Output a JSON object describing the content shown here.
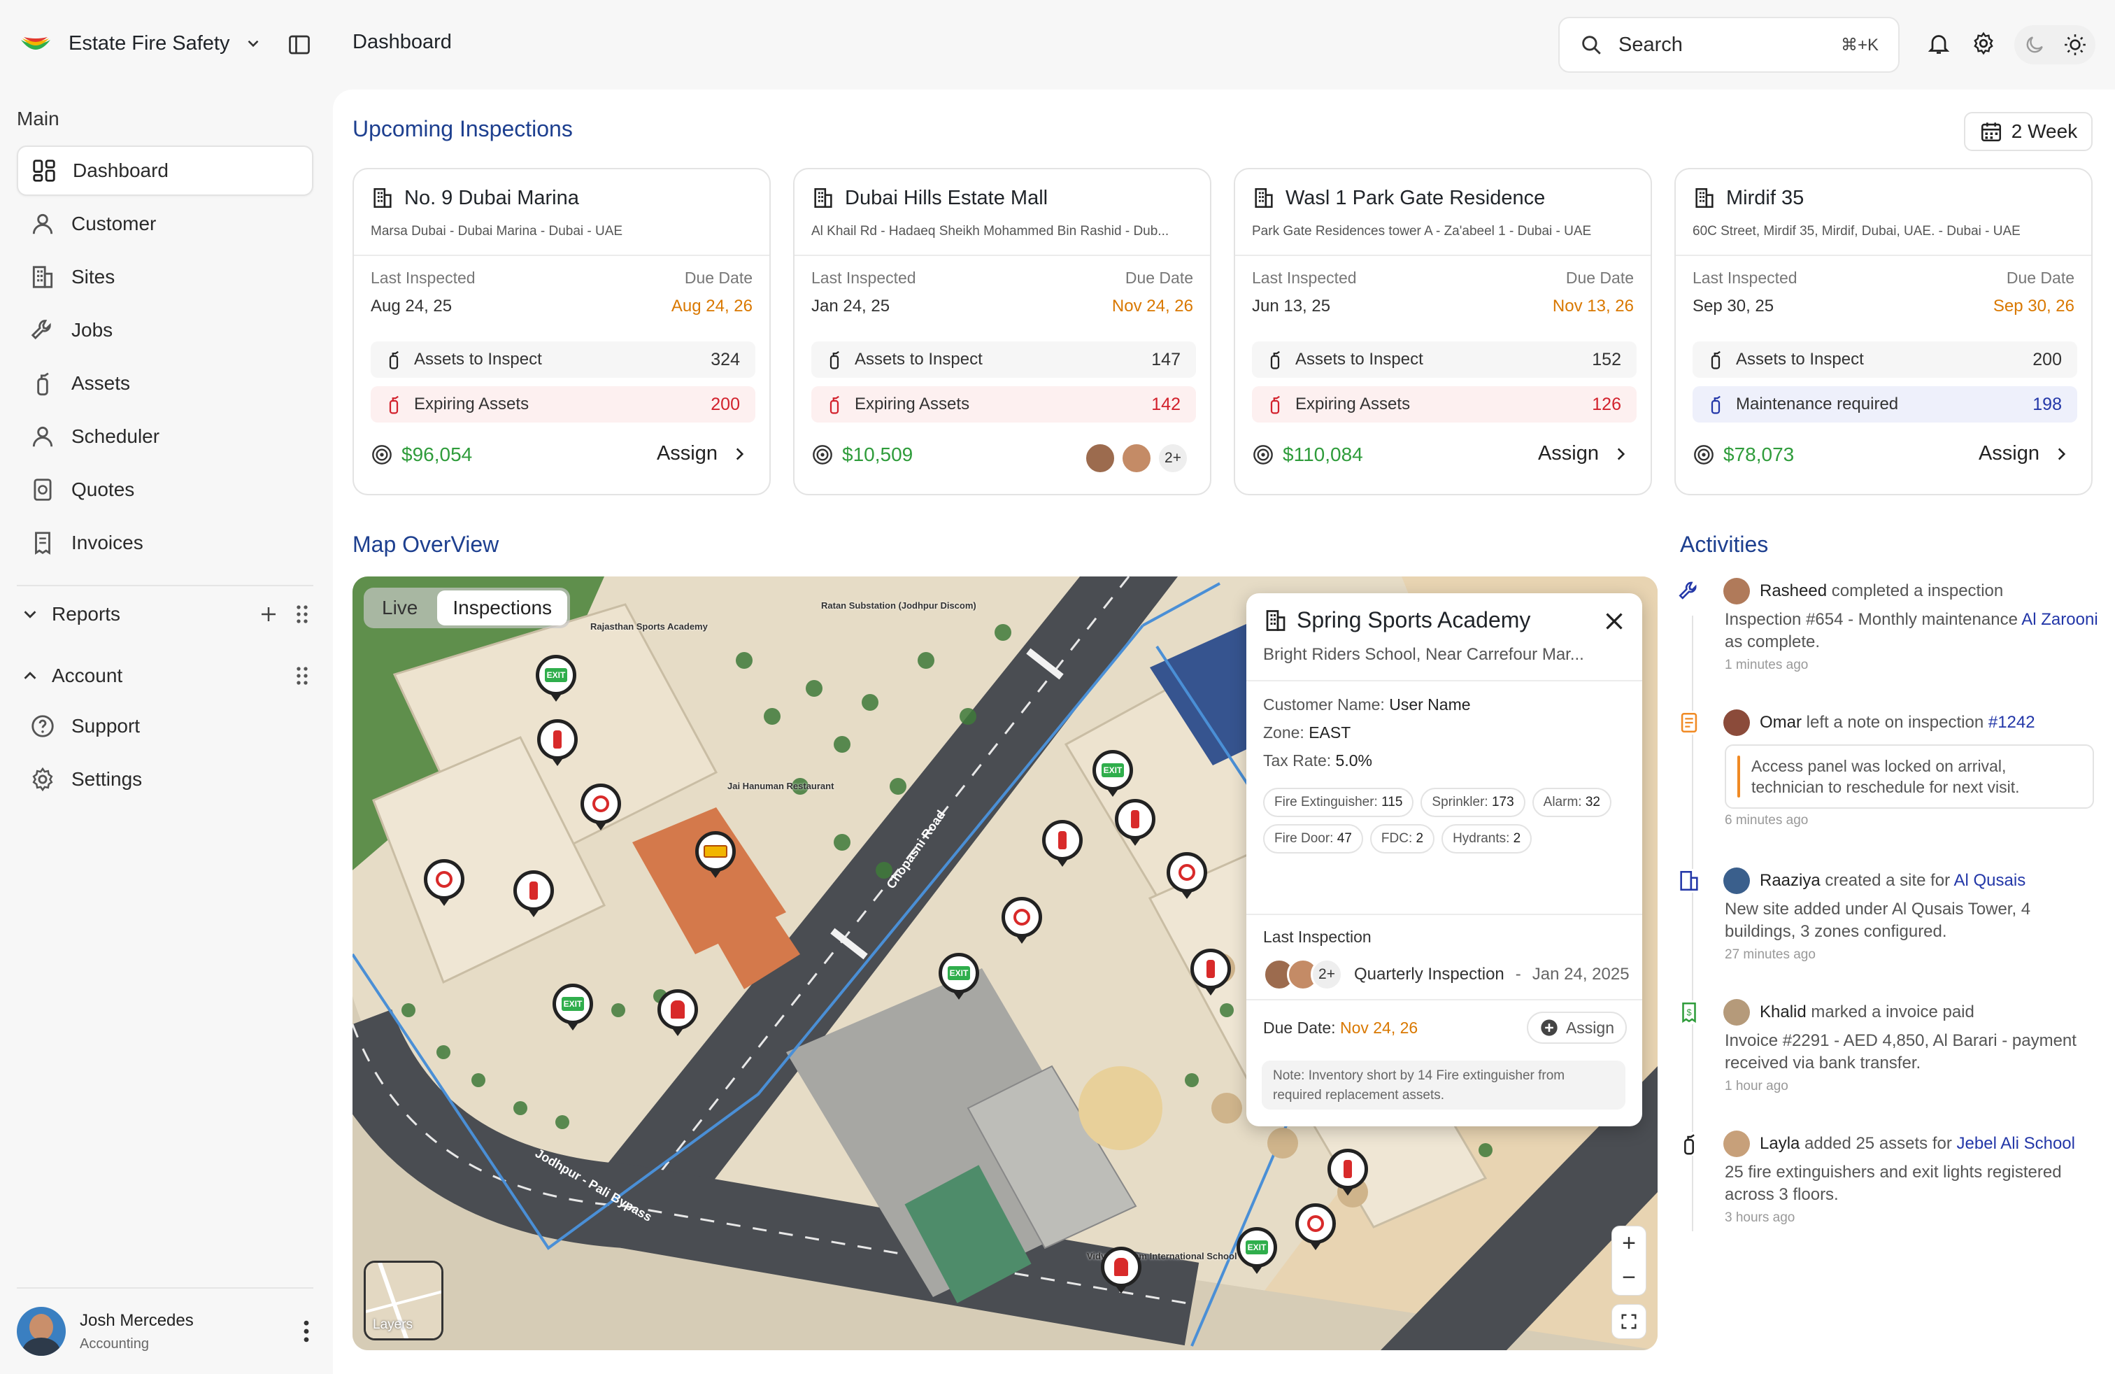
{
  "app": {
    "name": "Estate Fire Safety",
    "page_title": "Dashboard"
  },
  "search": {
    "placeholder": "Search",
    "shortcut": "⌘+K"
  },
  "sidebar": {
    "section_main": "Main",
    "items": [
      {
        "label": "Dashboard",
        "icon": "dashboard-icon",
        "active": true
      },
      {
        "label": "Customer",
        "icon": "user-icon"
      },
      {
        "label": "Sites",
        "icon": "building-icon"
      },
      {
        "label": "Jobs",
        "icon": "wrench-icon"
      },
      {
        "label": "Assets",
        "icon": "extinguisher-icon"
      },
      {
        "label": "Scheduler",
        "icon": "user-icon"
      },
      {
        "label": "Quotes",
        "icon": "quote-icon"
      },
      {
        "label": "Invoices",
        "icon": "invoice-icon"
      }
    ],
    "reports": "Reports",
    "account": "Account",
    "account_items": [
      {
        "label": "Support",
        "icon": "help-icon"
      },
      {
        "label": "Settings",
        "icon": "gear-icon"
      }
    ],
    "user": {
      "name": "Josh Mercedes",
      "role": "Accounting"
    }
  },
  "upcoming": {
    "title": "Upcoming Inspections",
    "range_label": "2 Week",
    "last_label": "Last Inspected",
    "due_label": "Due Date",
    "cards": [
      {
        "name": "No. 9 Dubai Marina",
        "address": "Marsa Dubai - Dubai Marina - Dubai - UAE",
        "last": "Aug 24, 25",
        "due": "Aug 24, 26",
        "row1_label": "Assets to Inspect",
        "row1_value": "324",
        "row2_label": "Expiring Assets",
        "row2_value": "200",
        "price": "$96,054",
        "action": "Assign"
      },
      {
        "name": "Dubai Hills Estate Mall",
        "address": "Al Khail Rd - Hadaeq Sheikh Mohammed Bin Rashid - Dub...",
        "last": "Jan 24, 25",
        "due": "Nov 24, 26",
        "row1_label": "Assets to Inspect",
        "row1_value": "147",
        "row2_label": "Expiring Assets",
        "row2_value": "142",
        "price": "$10,509",
        "more": "2+"
      },
      {
        "name": "Wasl 1 Park Gate Residence",
        "address": "Park Gate Residences tower A - Za'abeel 1 - Dubai - UAE",
        "last": "Jun 13, 25",
        "due": "Nov 13, 26",
        "row1_label": "Assets to Inspect",
        "row1_value": "152",
        "row2_label": "Expiring Assets",
        "row2_value": "126",
        "price": "$110,084",
        "action": "Assign"
      },
      {
        "name": "Mirdif 35",
        "address": "60C Street, Mirdif 35, Mirdif, Dubai, UAE. - Dubai - UAE",
        "last": "Sep 30, 25",
        "due": "Sep 30, 26",
        "row1_label": "Assets to Inspect",
        "row1_value": "200",
        "row2_label": "Maintenance required",
        "row2_value": "198",
        "price": "$78,073",
        "action": "Assign"
      }
    ]
  },
  "map": {
    "title": "Map OverView",
    "tabs": [
      "Live",
      "Inspections"
    ],
    "layers_label": "Layers",
    "labels": {
      "substation": "Ratan Substation (Jodhpur Discom)",
      "academy": "Rajasthan Sports Academy",
      "restaurant": "Jai Hanuman Restaurant",
      "road1": "Chopasni Road",
      "road2": "Jodhpur - Pali Bypass",
      "school": "Vidya Ashram International School"
    },
    "popup": {
      "title": "Spring Sports Academy",
      "subtitle": "Bright Riders School, Near Carrefour Mar...",
      "customer_label": "Customer Name:",
      "customer_value": "User Name",
      "zone_label": "Zone:",
      "zone_value": "EAST",
      "tax_label": "Tax Rate:",
      "tax_value": "5.0%",
      "chips": [
        {
          "label": "Fire Extinguisher:",
          "value": "115"
        },
        {
          "label": "Sprinkler:",
          "value": "173"
        },
        {
          "label": "Alarm:",
          "value": "32"
        },
        {
          "label": "Fire Door:",
          "value": "47"
        },
        {
          "label": "FDC:",
          "value": "2"
        },
        {
          "label": "Hydrants:",
          "value": "2"
        }
      ],
      "last_label": "Last Inspection",
      "last_more": "2+",
      "last_type": "Quarterly Inspection",
      "last_date": "Jan 24, 2025",
      "due_label": "Due Date:",
      "due_value": "Nov 24, 26",
      "assign": "Assign",
      "note": "Note: Inventory short by 14 Fire extinguisher from required replacement assets."
    }
  },
  "activities": {
    "title": "Activities",
    "items": [
      {
        "user": "Rasheed",
        "action": "completed a inspection",
        "body_pre": "Inspection #654 - Monthly maintenance",
        "body_link": "Al Zarooni",
        "body_post": "as complete.",
        "time": "1 minutes ago"
      },
      {
        "user": "Omar",
        "action": "left a note on inspection",
        "link": "#1242",
        "quote": "Access panel was locked on arrival, technician to reschedule for next visit.",
        "time": "6 minutes ago"
      },
      {
        "user": "Raaziya",
        "action": "created a site for",
        "link": "Al Qusais",
        "body": "New site added under Al Qusais Tower, 4 buildings, 3 zones configured.",
        "time": "27 minutes ago"
      },
      {
        "user": "Khalid",
        "action": "marked a invoice paid",
        "body": "Invoice #2291 - AED 4,850, Al Barari - payment received via bank transfer.",
        "time": "1 hour ago"
      },
      {
        "user": "Layla",
        "action": "added 25 assets for",
        "link": "Jebel Ali School",
        "body": "25 fire extinguishers and exit lights registered across 3 floors.",
        "time": "3 hours ago"
      }
    ]
  },
  "colors": {
    "accent": "#1d3f8f",
    "due": "#d97800",
    "price": "#2f9c3b",
    "danger": "#d2222d",
    "link": "#2337a8"
  }
}
